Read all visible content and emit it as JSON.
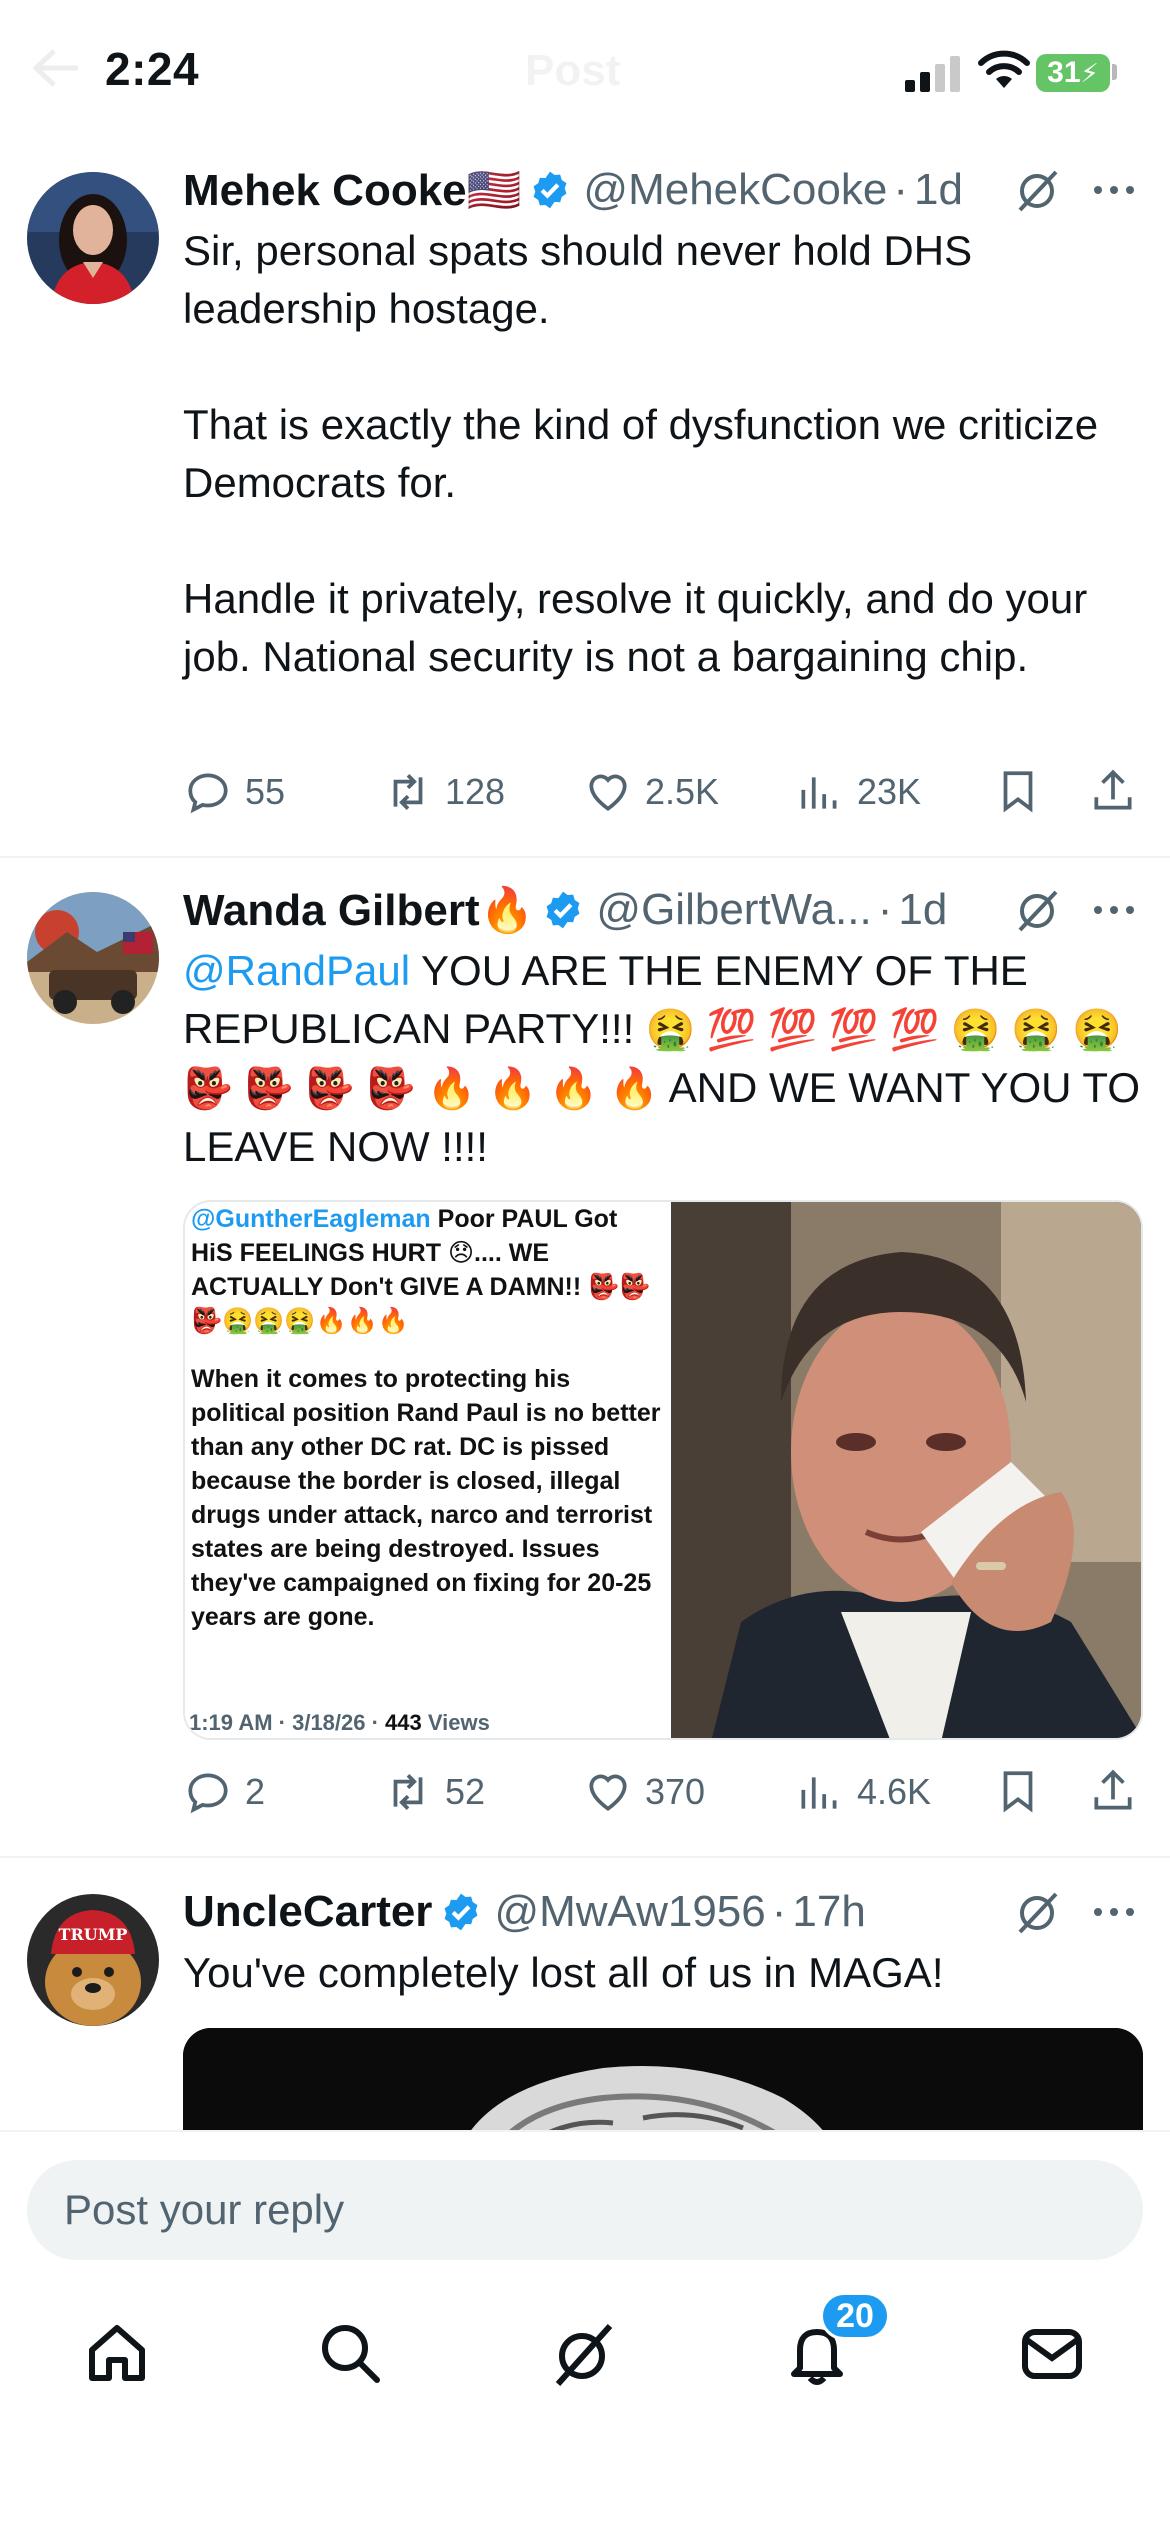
{
  "status_bar": {
    "time": "2:24",
    "battery": "31",
    "title_ghost": "Post"
  },
  "tweets": [
    {
      "name": "Mehek Cooke🇺🇸",
      "handle": "@MehekCooke",
      "time": "1d",
      "paragraphs": [
        "Sir, personal spats should never hold DHS leadership hostage.",
        "That is exactly the kind of dysfunction we criticize Democrats for.",
        "Handle it privately, resolve it quickly, and do your job. National security is not a bargaining chip."
      ],
      "replies": "55",
      "reposts": "128",
      "likes": "2.5K",
      "views": "23K"
    },
    {
      "name": "Wanda Gilbert🔥",
      "handle": "@GilbertWa...",
      "time": "1d",
      "mention": "@RandPaul",
      "text_a": " YOU ARE THE ENEMY OF THE REPUBLICAN PARTY!!! ",
      "emoji_a": "🤮 💯 💯 💯 💯 🤮 🤮 🤮 👺 👺 👺 👺 🔥 🔥 🔥 🔥",
      "text_b": "AND WE WANT YOU TO LEAVE NOW !!!!",
      "media": {
        "quoted_handle": "@GuntherEagleman",
        "quoted_lead": " Poor PAUL Got HiS FEELINGS HURT 😞.... WE ACTUALLY Don't GIVE A DAMN!! 👺👺👺🤮🤮🤮🔥🔥🔥",
        "quoted_body": "When it comes to protecting his political position Rand Paul is no better than any other DC rat. DC is pissed because the border is closed, illegal drugs under attack, narco and terrorist states are being destroyed. Issues they've campaigned on fixing for 20-25 years are gone.",
        "quoted_meta": "1:19 AM · 3/18/26 · ",
        "quoted_views": "443",
        "quoted_views_label": " Views"
      },
      "replies": "2",
      "reposts": "52",
      "likes": "370",
      "views": "4.6K"
    },
    {
      "name": "UncleCarter",
      "handle": "@MwAw1956",
      "time": "17h",
      "text": "You've completely lost all of us in MAGA!",
      "avatar_hat_text": "TRUMP"
    }
  ],
  "reply": {
    "placeholder": "Post your reply"
  },
  "tabbar": {
    "notifications_count": "20"
  },
  "colors": {
    "accent": "#1d9bf0",
    "muted": "#536471",
    "battery": "#65c466"
  }
}
